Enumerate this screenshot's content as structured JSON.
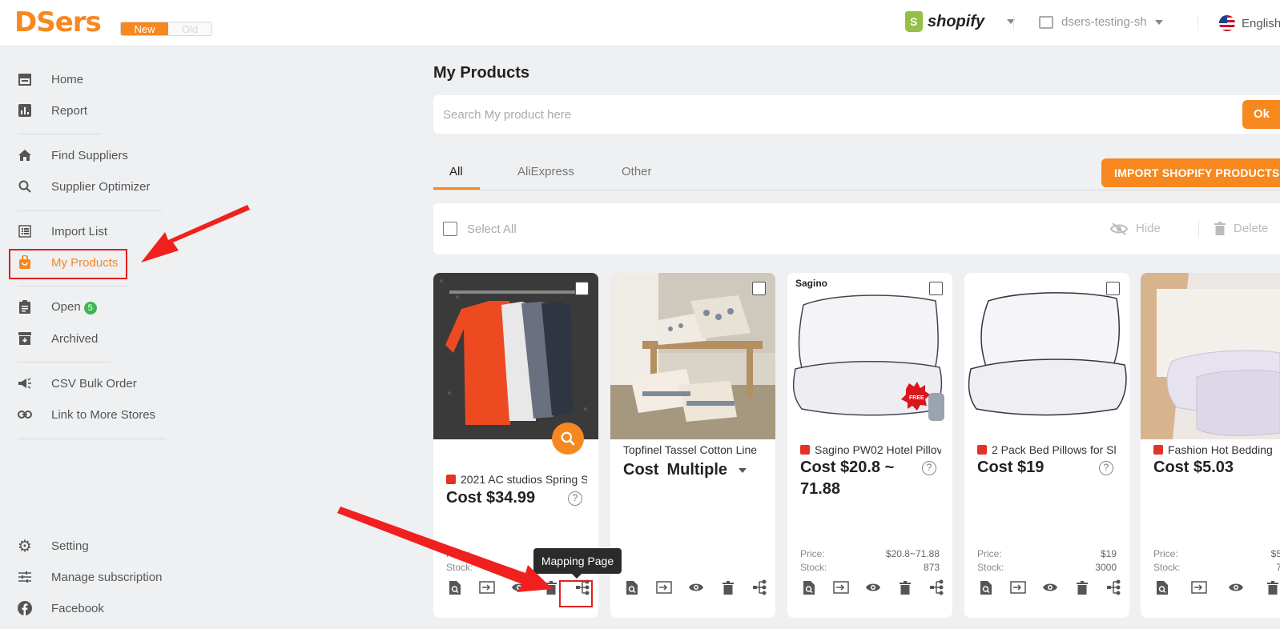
{
  "header": {
    "logo": "DSers",
    "version_new": "New",
    "version_old": "Old",
    "platform": "shopify",
    "store": "dsers-testing-sh",
    "language": "English"
  },
  "sidebar": {
    "items": [
      {
        "label": "Home",
        "icon": "store-icon"
      },
      {
        "label": "Report",
        "icon": "bar-chart-icon"
      },
      {
        "label": "Find Suppliers",
        "icon": "house-icon"
      },
      {
        "label": "Supplier Optimizer",
        "icon": "search-icon"
      },
      {
        "label": "Import List",
        "icon": "list-icon"
      },
      {
        "label": "My Products",
        "icon": "shopping-bag-icon"
      },
      {
        "label": "Open",
        "icon": "clipboard-icon",
        "badge": "5"
      },
      {
        "label": "Archived",
        "icon": "archive-icon"
      },
      {
        "label": "CSV Bulk Order",
        "icon": "megaphone-icon"
      },
      {
        "label": "Link to More Stores",
        "icon": "link-icon"
      },
      {
        "label": "Setting",
        "icon": "gear-icon"
      },
      {
        "label": "Manage subscription",
        "icon": "sliders-icon"
      },
      {
        "label": "Facebook",
        "icon": "facebook-icon"
      }
    ]
  },
  "main": {
    "title": "My Products",
    "search_placeholder": "Search My product here",
    "search_button": "Ok",
    "tabs": [
      "All",
      "AliExpress",
      "Other"
    ],
    "import_button": "IMPORT SHOPIFY PRODUCTS",
    "select_all": "Select All",
    "hide": "Hide",
    "delete": "Delete"
  },
  "tooltip": "Mapping Page",
  "cards": [
    {
      "title": "2021 AC studios Spring S",
      "cost": "Cost $34.99",
      "price_label": "Price:",
      "price": "",
      "stock_label": "Stock:",
      "stock": ""
    },
    {
      "title": "Topfinel Tassel Cotton Line",
      "cost_label": "Cost",
      "cost": "Multiple"
    },
    {
      "title": "Sagino PW02 Hotel Pillov",
      "cost": "Cost $20.8 ~ 71.88",
      "price_label": "Price:",
      "price": "$20.8~71.88",
      "stock_label": "Stock:",
      "stock": "873",
      "brand": "Sagino",
      "badge": "FREE"
    },
    {
      "title": "2 Pack Bed Pillows for Sl",
      "cost": "Cost $19",
      "price_label": "Price:",
      "price": "$19",
      "stock_label": "Stock:",
      "stock": "3000"
    },
    {
      "title": "Fashion Hot Bedding",
      "cost": "Cost $5.03",
      "price_label": "Price:",
      "price": "$5",
      "stock_label": "Stock:",
      "stock": "7"
    }
  ],
  "colors": {
    "accent": "#f6881f",
    "highlight": "#e02020",
    "badge_green": "#3fb552"
  }
}
